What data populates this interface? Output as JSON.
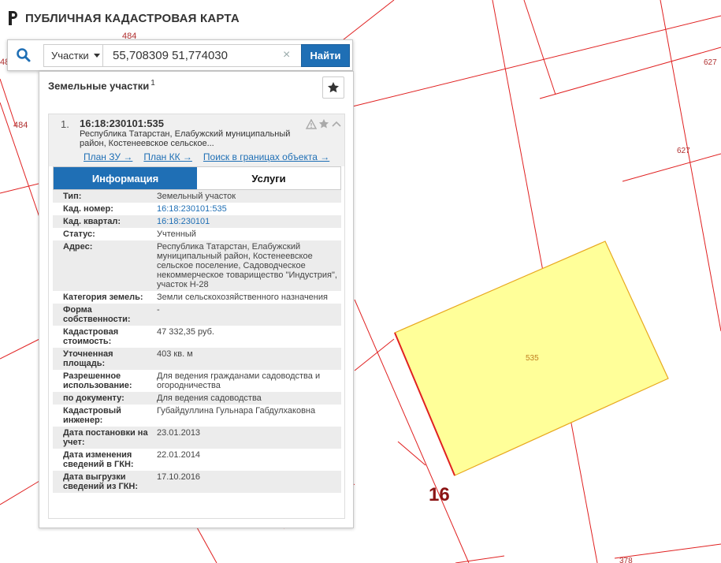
{
  "app": {
    "title": "ПУБЛИЧНАЯ КАДАСТРОВАЯ КАРТА"
  },
  "search": {
    "type_label": "Участки",
    "query": "55,708309 51,774030",
    "clear_label": "×",
    "button_label": "Найти"
  },
  "panel": {
    "title": "Земельные участки",
    "count": "1",
    "result": {
      "index": "1.",
      "cad_number": "16:18:230101:535",
      "address_short": "Республика Татарстан, Елабужский муниципальный район, Костенеевское сельское...",
      "links": [
        "План ЗУ →",
        "План КК →",
        "Поиск в границах объекта →"
      ]
    },
    "tabs": [
      "Информация",
      "Услуги"
    ],
    "rows": [
      {
        "key": "Тип:",
        "value": "Земельный участок"
      },
      {
        "key": "Кад. номер:",
        "value": "16:18:230101:535",
        "link": true
      },
      {
        "key": "Кад. квартал:",
        "value": "16:18:230101",
        "link": true
      },
      {
        "key": "Статус:",
        "value": "Учтенный"
      },
      {
        "key": "Адрес:",
        "value": "Республика Татарстан, Елабужский муниципальный район, Костенеевское сельское поселение, Садоводческое некоммерческое товарищество \"Индустрия\", участок Н-28"
      },
      {
        "key": "Категория земель:",
        "value": "Земли сельскохозяйственного назначения"
      },
      {
        "key": "Форма собственности:",
        "value": "-"
      },
      {
        "key": "Кадастровая стоимость:",
        "value": "47 332,35 руб."
      },
      {
        "key": "Уточненная площадь:",
        "value": "403 кв. м"
      },
      {
        "key": "Разрешенное использование:",
        "value": "Для ведения гражданами садоводства и огородничества"
      },
      {
        "key": "по документу:",
        "value": "Для ведения садоводства"
      },
      {
        "key": "Кадастровый инженер:",
        "value": "Губайдуллина Гульнара Габдулхаковна"
      },
      {
        "key": "Дата постановки на учет:",
        "value": "23.01.2013"
      },
      {
        "key": "Дата изменения сведений в ГКН:",
        "value": "22.01.2014"
      },
      {
        "key": "Дата выгрузки сведений из ГКН:",
        "value": "17.10.2016"
      }
    ]
  },
  "map": {
    "labels": {
      "l484a": "484",
      "l484b": "484",
      "l48": "48",
      "l627a": "627",
      "l627b": "627",
      "l535": "535",
      "l16": "16",
      "l378": "378"
    },
    "colors": {
      "boundary": "#e02020",
      "parcel_fill": "#ffff99",
      "parcel_stroke": "#e8a81e",
      "accent": "#1f6fb5"
    }
  }
}
